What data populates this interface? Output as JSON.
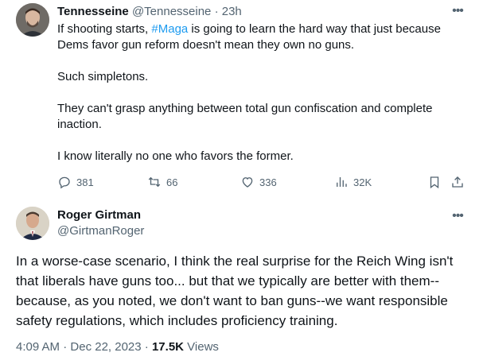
{
  "tweet1": {
    "author_name": "Tennesseine",
    "handle": "@Tennesseine",
    "separator": "·",
    "time": "23h",
    "text_line1_pre": "If shooting starts, ",
    "hashtag": "#Maga",
    "text_line1_post": " is going to learn the hard way that just because Dems favor gun reform doesn't mean they own no guns.",
    "para2": "Such simpletons.",
    "para3": "They can't grasp anything between total gun confiscation and complete inaction.",
    "para4": "I know literally no one who favors the former.",
    "more_icon": "more-horizontal-icon",
    "actions": {
      "replies": "381",
      "reposts": "66",
      "likes": "336",
      "views": "32K"
    },
    "hashtag_color": "#1d9bf0"
  },
  "tweet2": {
    "author_name": "Roger Girtman",
    "handle": "@GirtmanRoger",
    "text": "In a worse-case scenario, I think the real surprise for the Reich Wing isn't that liberals have guns too... but that we typically are better with them--because, as you noted, we don't want to ban guns--we want responsible safety regulations, which includes proficiency training.",
    "time": "4:09 AM",
    "date_separator": "·",
    "date": "Dec 22, 2023",
    "views_separator": "·",
    "views_count": "17.5K",
    "views_label": "Views"
  },
  "colors": {
    "text": "#0f1419",
    "muted": "#536471",
    "accent": "#1d9bf0"
  }
}
